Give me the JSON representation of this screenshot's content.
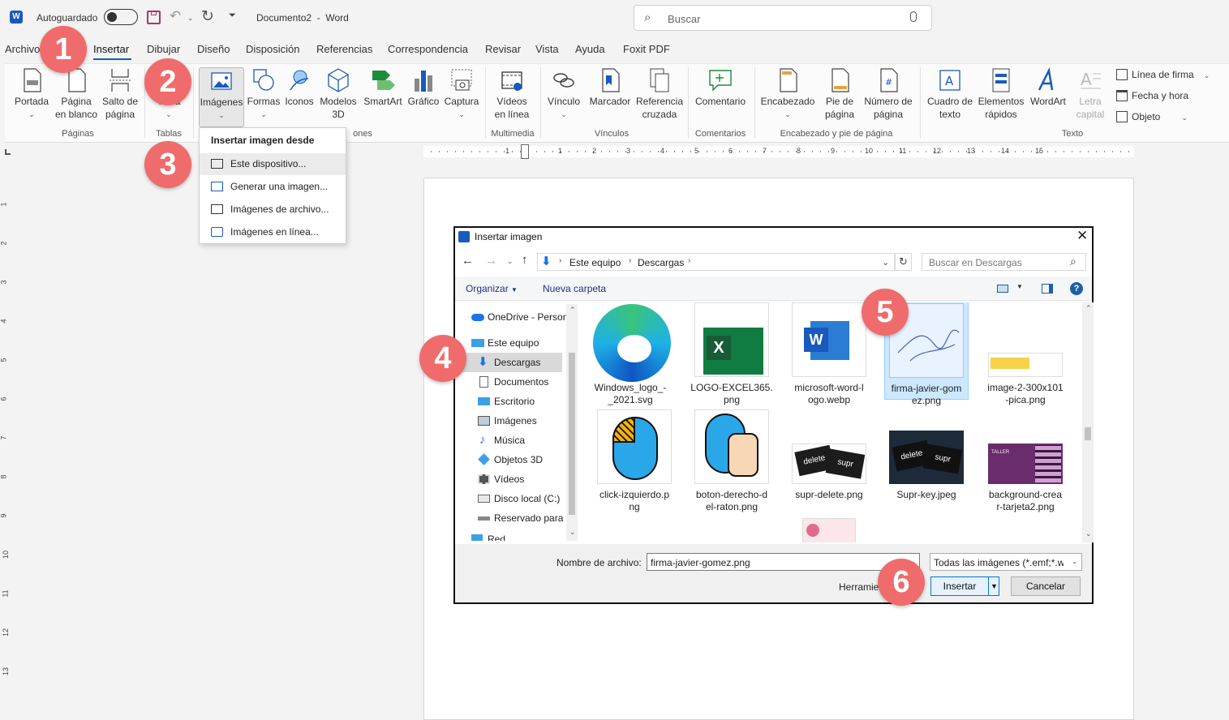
{
  "titlebar": {
    "autosave_label": "Autoguardado",
    "doc_title": "Documento2",
    "app_name": "Word",
    "search_placeholder": "Buscar"
  },
  "tabs": [
    "Archivo",
    "Insertar",
    "Dibujar",
    "Diseño",
    "Disposición",
    "Referencias",
    "Correspondencia",
    "Revisar",
    "Vista",
    "Ayuda",
    "Foxit PDF"
  ],
  "ribbon": {
    "portada": "Portada",
    "pagina_blanco": "Página\nen blanco",
    "salto": "Salto de\npágina",
    "tabla": "Tabla",
    "imagenes": "Imágenes",
    "formas": "Formas",
    "iconos": "Iconos",
    "modelos": "Modelos\n3D",
    "smartart": "SmartArt",
    "grafico": "Gráfico",
    "captura": "Captura",
    "videos": "Vídeos\nen línea",
    "vinculo": "Vínculo",
    "marcador": "Marcador",
    "referencia": "Referencia\ncruzada",
    "comentario": "Comentario",
    "encabezado": "Encabezado",
    "pie": "Pie de\npágina",
    "numero": "Número de\npágina",
    "cuadro": "Cuadro de\ntexto",
    "elementos": "Elementos\nrápidos",
    "wordart": "WordArt",
    "letra": "Letra\ncapital",
    "linea_firma": "Línea de firma",
    "fecha": "Fecha y hora",
    "objeto": "Objeto",
    "groups": {
      "paginas": "Páginas",
      "tablas": "Tablas",
      "ilustraciones_tail": "ones",
      "multimedia": "Multimedia",
      "vinculos": "Vínculos",
      "comentarios": "Comentarios",
      "encabezado": "Encabezado y pie de página",
      "texto": "Texto"
    }
  },
  "ruler": {
    "ticks": [
      "1",
      "1",
      "2",
      "3",
      "4",
      "5",
      "6",
      "7",
      "8",
      "9",
      "10",
      "11",
      "12",
      "13",
      "14",
      "15"
    ],
    "left_ticks": [
      "1",
      "2",
      "3",
      "4",
      "5",
      "6",
      "7",
      "8",
      "9",
      "10",
      "11",
      "12",
      "13"
    ]
  },
  "dropdown": {
    "header": "Insertar imagen desde",
    "items": [
      "Este dispositivo...",
      "Generar una imagen...",
      "Imágenes de archivo...",
      "Imágenes en línea..."
    ]
  },
  "dialog": {
    "title": "Insertar imagen",
    "path": [
      "Este equipo",
      "Descargas"
    ],
    "search_placeholder": "Buscar en Descargas",
    "organizar": "Organizar",
    "nueva_carpeta": "Nueva carpeta",
    "nav": [
      "OneDrive - Person",
      "Este equipo",
      "Descargas",
      "Documentos",
      "Escritorio",
      "Imágenes",
      "Música",
      "Objetos 3D",
      "Vídeos",
      "Disco local (C:)",
      "Reservado para e",
      "Red"
    ],
    "files": [
      "Windows_logo_-\n_2021.svg",
      "LOGO-EXCEL365.\npng",
      "microsoft-word-l\nogo.webp",
      "firma-javier-gom\nez.png",
      "image-2-300x101\n-pica.png",
      "click-izquierdo.p\nng",
      "boton-derecho-d\nel-raton.png",
      "supr-delete.png",
      "Supr-key.jpeg",
      "background-crea\nr-tarjeta2.png"
    ],
    "thumb_text": {
      "excel_letter": "X",
      "word_letter": "W",
      "key1": "delete",
      "key2": "supr",
      "taller": "TALLER"
    },
    "filename_label": "Nombre de archivo:",
    "filename_value": "firma-javier-gomez.png",
    "filter": "Todas las imágenes (*.emf;*.wn",
    "herramientas": "Herramie",
    "insertar": "Insertar",
    "cancelar": "Cancelar"
  },
  "badges": [
    "1",
    "2",
    "3",
    "4",
    "5",
    "6"
  ],
  "colors": {
    "accent": "#185abd",
    "badge": "#f06b6b",
    "selected": "#cce8ff",
    "nav_selected": "#d9d9d9"
  }
}
